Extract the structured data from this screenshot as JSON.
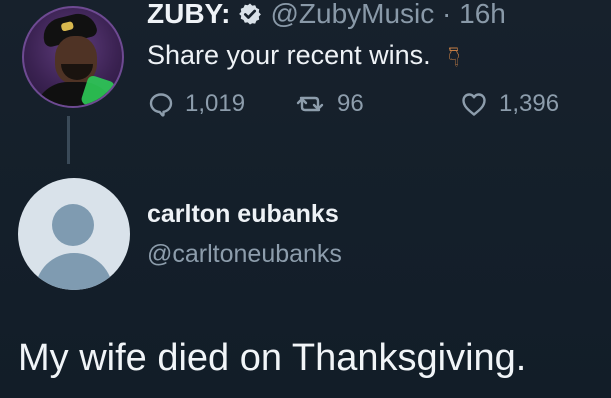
{
  "tweet": {
    "display_name": "ZUBY:",
    "handle_time": "@ZubyMusic · 16h",
    "text": "Share your recent wins.",
    "icons": {
      "verified": "verified-badge-icon",
      "pointer": "backhand-index-pointing-down-icon"
    },
    "stats": {
      "replies": "1,019",
      "retweets": "96",
      "likes": "1,396"
    }
  },
  "reply": {
    "display_name": "carlton eubanks",
    "handle": "@carltoneubanks",
    "text": "My wife died on Thanksgiving."
  },
  "colors": {
    "background": "#14202d",
    "primary_text": "#eef2f6",
    "secondary_text": "#8d9dac",
    "default_avatar": "#7f9bb1"
  }
}
